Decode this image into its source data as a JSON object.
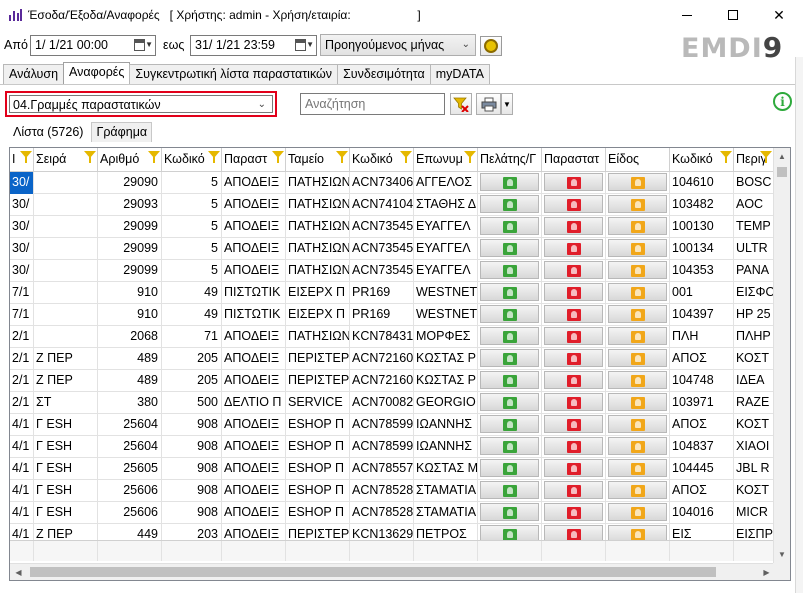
{
  "window": {
    "title": "Έσοδα/Έξοδα/Αναφορές   [ Χρήστης: admin - Χρήση/εταιρία:                    ]",
    "minimize": "–",
    "maximize": "□",
    "close": "✕"
  },
  "filters": {
    "from_label": "Από",
    "from_value": "1/  1/21 00:00",
    "to_label": "εως",
    "to_value": "31/  1/21 23:59",
    "period_value": "Προηγούμενος μήνας"
  },
  "logo": {
    "text": "EMDI",
    "suffix": "9"
  },
  "tabs": [
    {
      "label": "Ανάλυση",
      "active": false
    },
    {
      "label": "Αναφορές",
      "active": true
    },
    {
      "label": "Συγκεντρωτική λίστα παραστατικών",
      "active": false
    },
    {
      "label": "Συνδεσιμότητα",
      "active": false
    },
    {
      "label": "myDATA",
      "active": false
    }
  ],
  "report": {
    "selected": "04.Γραμμές παραστατικών"
  },
  "search": {
    "placeholder": "Αναζήτηση"
  },
  "subtabs": [
    {
      "label": "Λίστα (5726)",
      "active": true
    },
    {
      "label": "Γράφημα",
      "active": false
    }
  ],
  "icons": {
    "clear_filter": "filter-clear-icon",
    "print": "printer-icon",
    "info": "info-icon",
    "refresh": "refresh-icon"
  },
  "colors": {
    "highlight": "#e2001a",
    "selection": "#0a64c8",
    "info": "#2eaa3c"
  },
  "table": {
    "columns": [
      "Ι",
      "Σειρά",
      "Αριθμό",
      "Κωδικό",
      "Παραστ",
      "Ταμείο",
      "Κωδικό",
      "Επωνυμ",
      "Πελάτης/Γ",
      "Παραστατ",
      "Είδος",
      "Κωδικό",
      "Περιγ"
    ],
    "rows": [
      [
        "30/",
        "",
        "29090",
        "5",
        "ΑΠΟΔΕΙΞ",
        "ΠΑΤΗΣΙΩΝ",
        "ACN73406",
        "ΑΓΓΕΛΟΣ",
        "104610",
        "BOSC"
      ],
      [
        "30/",
        "",
        "29093",
        "5",
        "ΑΠΟΔΕΙΞ",
        "ΠΑΤΗΣΙΩΝ",
        "ACN74104",
        "ΣΤΑΘΗΣ Δ",
        "103482",
        "AOC"
      ],
      [
        "30/",
        "",
        "29099",
        "5",
        "ΑΠΟΔΕΙΞ",
        "ΠΑΤΗΣΙΩΝ",
        "ACN73545",
        "ΕΥΑΓΓΕΛ",
        "100130",
        "TEMP"
      ],
      [
        "30/",
        "",
        "29099",
        "5",
        "ΑΠΟΔΕΙΞ",
        "ΠΑΤΗΣΙΩΝ",
        "ACN73545",
        "ΕΥΑΓΓΕΛ",
        "100134",
        "ULTR"
      ],
      [
        "30/",
        "",
        "29099",
        "5",
        "ΑΠΟΔΕΙΞ",
        "ΠΑΤΗΣΙΩΝ",
        "ACN73545",
        "ΕΥΑΓΓΕΛ",
        "104353",
        "PANA"
      ],
      [
        "7/1",
        "",
        "910",
        "49",
        "ΠΙΣΤΩΤΙΚ",
        "ΕΙΣΕΡΧ Π",
        "PR169",
        "WESTNET",
        "001",
        "ΕΙΣΦΟ"
      ],
      [
        "7/1",
        "",
        "910",
        "49",
        "ΠΙΣΤΩΤΙΚ",
        "ΕΙΣΕΡΧ Π",
        "PR169",
        "WESTNET",
        "104397",
        "HP 25"
      ],
      [
        "2/1",
        "",
        "2068",
        "71",
        "ΑΠΟΔΕΙΞ",
        "ΠΑΤΗΣΙΩΝ",
        "KCN78431",
        "ΜΟΡΦΕΣ",
        "ΠΛΗ",
        "ΠΛΗΡ"
      ],
      [
        "2/1",
        "Ζ ΠΕΡ",
        "489",
        "205",
        "ΑΠΟΔΕΙΞ",
        "ΠΕΡΙΣΤΕΡ",
        "ACN72160",
        "ΚΩΣΤΑΣ Ρ",
        "ΑΠΟΣ",
        "ΚΟΣΤ"
      ],
      [
        "2/1",
        "Ζ ΠΕΡ",
        "489",
        "205",
        "ΑΠΟΔΕΙΞ",
        "ΠΕΡΙΣΤΕΡ",
        "ACN72160",
        "ΚΩΣΤΑΣ Ρ",
        "104748",
        "ΙΔΕΑ"
      ],
      [
        "2/1",
        "ΣΤ",
        "380",
        "500",
        "ΔΕΛΤΙΟ Π",
        "SERVICE",
        "ACN70082",
        "GEORGIO",
        "103971",
        "RAZE"
      ],
      [
        "4/1",
        "Γ ESH",
        "25604",
        "908",
        "ΑΠΟΔΕΙΞ",
        "ESHOP Π",
        "ACN78599",
        "ΙΩΑΝΝΗΣ",
        "ΑΠΟΣ",
        "ΚΟΣΤ"
      ],
      [
        "4/1",
        "Γ ESH",
        "25604",
        "908",
        "ΑΠΟΔΕΙΞ",
        "ESHOP Π",
        "ACN78599",
        "ΙΩΑΝΝΗΣ",
        "104837",
        "XIAOI"
      ],
      [
        "4/1",
        "Γ ESH",
        "25605",
        "908",
        "ΑΠΟΔΕΙΞ",
        "ESHOP Π",
        "ACN78557",
        "ΚΩΣΤΑΣ Μ",
        "104445",
        "JBL R"
      ],
      [
        "4/1",
        "Γ ESH",
        "25606",
        "908",
        "ΑΠΟΔΕΙΞ",
        "ESHOP Π",
        "ACN78528",
        "ΣΤΑΜΑΤΙΑ",
        "ΑΠΟΣ",
        "ΚΟΣΤ"
      ],
      [
        "4/1",
        "Γ ESH",
        "25606",
        "908",
        "ΑΠΟΔΕΙΞ",
        "ESHOP Π",
        "ACN78528",
        "ΣΤΑΜΑΤΙΑ",
        "104016",
        "MICR"
      ],
      [
        "4/1",
        "Ζ ΠΕΡ",
        "449",
        "203",
        "ΑΠΟΔΕΙΞ",
        "ΠΕΡΙΣΤΕΡ",
        "KCN13629",
        "ΠΕΤΡΟΣ",
        "ΕΙΣ",
        "ΕΙΣΠΡ"
      ]
    ]
  }
}
